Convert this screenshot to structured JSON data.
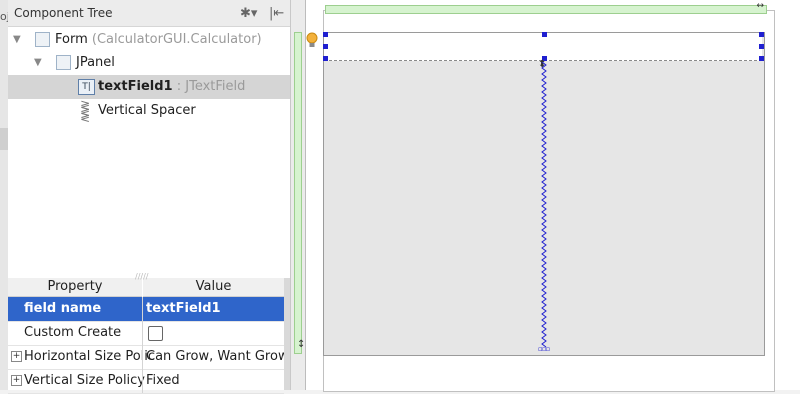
{
  "left_edge": {
    "fragment": "oj"
  },
  "component_tree": {
    "title": "Component Tree",
    "header_icons": [
      "gear-icon",
      "pin-left-icon"
    ],
    "nodes": [
      {
        "label": "Form",
        "sublabel": "(CalculatorGUI.Calculator)",
        "icon": "form-icon",
        "expanded": true,
        "selected": false
      },
      {
        "label": "JPanel",
        "sublabel": "",
        "icon": "panel-icon",
        "expanded": true,
        "selected": false
      },
      {
        "label": "textField1",
        "sublabel": ": JTextField",
        "icon": "textfield-icon",
        "selected": true
      },
      {
        "label": "Vertical Spacer",
        "sublabel": "",
        "icon": "spacer-icon",
        "selected": false
      }
    ]
  },
  "properties": {
    "headers": {
      "property": "Property",
      "value": "Value"
    },
    "rows": [
      {
        "name": "field name",
        "value": "textField1",
        "selected": true,
        "expandable": false
      },
      {
        "name": "Custom Create",
        "value": "",
        "checkbox": true,
        "checked": false,
        "expandable": false
      },
      {
        "name": "Horizontal Size Policy",
        "display_name": "Horizontal Size Polic",
        "value": "Can Grow, Want Grow",
        "expandable": true
      },
      {
        "name": "Vertical Size Policy",
        "value": "Fixed",
        "expandable": true
      }
    ]
  },
  "design_surface": {
    "top_resize_glyph": "↔",
    "left_resize_glyph": "↕",
    "spacer_glyph_top": "⬍",
    "spacer_glyph_bottom": "▫▫▫",
    "colors": {
      "selection_handle": "#1f1fd0",
      "layout_strip": "#d6f3cf",
      "panel_fill": "#e6e6e6",
      "selected_property_row": "#2f65ca"
    }
  }
}
